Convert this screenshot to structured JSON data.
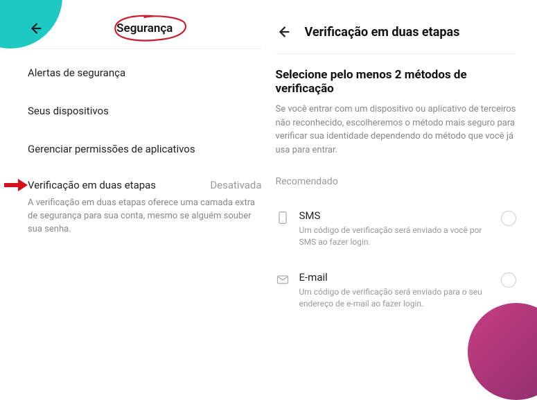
{
  "left": {
    "title": "Segurança",
    "items": [
      {
        "label": "Alertas de segurança"
      },
      {
        "label": "Seus dispositivos"
      },
      {
        "label": "Gerenciar permissões de aplicativos"
      }
    ],
    "two_step": {
      "label": "Verificação em duas etapas",
      "status": "Desativada",
      "desc": "A verificação em duas etapas oferece uma camada extra de segurança para sua conta, mesmo se alguém souber sua senha."
    }
  },
  "right": {
    "title": "Verificação em duas etapas",
    "subtitle": "Selecione pelo menos 2 métodos de verificação",
    "desc": "Se você entrar com um dispositivo ou aplicativo de terceiros não reconhecido, escolheremos o método mais seguro para verificar sua identidade dependendo do método que você já usa para entrar.",
    "section_label": "Recomendado",
    "methods": [
      {
        "title": "SMS",
        "desc": "Um código de verificação será enviado a você por SMS ao fazer login."
      },
      {
        "title": "E-mail",
        "desc": "Um código de verificação será enviado para o seu endereço de e-mail ao fazer login."
      }
    ]
  }
}
